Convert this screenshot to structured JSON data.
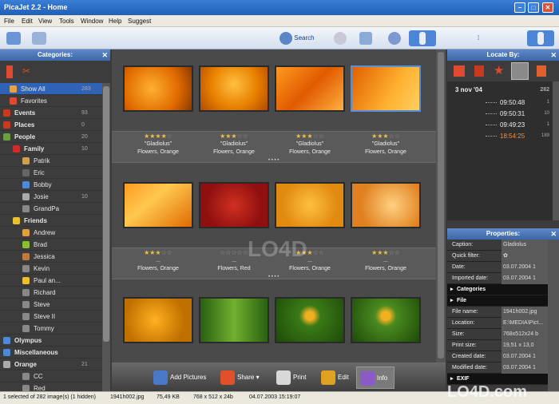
{
  "window": {
    "title": "PicaJet 2.2 - Home"
  },
  "menu": [
    "File",
    "Edit",
    "View",
    "Tools",
    "Window",
    "Help",
    "Suggest"
  ],
  "toolbar": {
    "search_label": "Search"
  },
  "categories_panel": {
    "title": "Categories:",
    "items": [
      {
        "label": "Show All",
        "count": "283"
      },
      {
        "label": "Favorites",
        "count": ""
      },
      {
        "label": "Events",
        "count": "93"
      },
      {
        "label": "Places",
        "count": "0"
      },
      {
        "label": "People",
        "count": "20"
      },
      {
        "label": "Family",
        "count": "10"
      },
      {
        "label": "Patrik",
        "count": ""
      },
      {
        "label": "Eric",
        "count": ""
      },
      {
        "label": "Bobby",
        "count": ""
      },
      {
        "label": "Josie",
        "count": "10"
      },
      {
        "label": "GrandPa",
        "count": ""
      },
      {
        "label": "Friends",
        "count": ""
      },
      {
        "label": "Andrew",
        "count": ""
      },
      {
        "label": "Brad",
        "count": ""
      },
      {
        "label": "Jessica",
        "count": ""
      },
      {
        "label": "Kevin",
        "count": ""
      },
      {
        "label": "Paul an...",
        "count": ""
      },
      {
        "label": "Richard",
        "count": ""
      },
      {
        "label": "Steve",
        "count": ""
      },
      {
        "label": "Steve II",
        "count": ""
      },
      {
        "label": "Tommy",
        "count": ""
      },
      {
        "label": "Olympus",
        "count": ""
      },
      {
        "label": "Miscellaneous",
        "count": ""
      },
      {
        "label": "Orange",
        "count": "21"
      },
      {
        "label": "CC",
        "count": ""
      },
      {
        "label": "Red",
        "count": ""
      }
    ]
  },
  "thumbnails": {
    "row1": [
      {
        "stars": 4,
        "title": "\"Gladiolus\"",
        "tags": "Flowers, Orange"
      },
      {
        "stars": 3,
        "title": "\"Gladiolus\"",
        "tags": "Flowers, Orange"
      },
      {
        "stars": 3,
        "title": "\"Gladiolus\"",
        "tags": "Flowers, Orange"
      },
      {
        "stars": 3,
        "title": "\"Gladiolus\"",
        "tags": "Flowers, Orange"
      }
    ],
    "row2": [
      {
        "stars": 3,
        "title": "...",
        "tags": "Flowers, Orange"
      },
      {
        "stars": 0,
        "title": "...",
        "tags": "Flowers, Red"
      },
      {
        "stars": 3,
        "title": "...",
        "tags": "Flowers, Orange"
      },
      {
        "stars": 3,
        "title": "...",
        "tags": "Flowers, Orange"
      }
    ],
    "band_dots": "• • • •"
  },
  "bottom_actions": {
    "add": "Add Pictures",
    "share": "Share",
    "print": "Print",
    "edit": "Edit",
    "info": "Info"
  },
  "locate_panel": {
    "title": "Locate By:",
    "date": "3 nov '04",
    "date_count": "282",
    "times": [
      {
        "time": "09:50:48",
        "count": "1"
      },
      {
        "time": "09:50:31",
        "count": "10"
      },
      {
        "time": "09:49:23",
        "count": "1"
      },
      {
        "time": "18:54:25",
        "count": "189"
      }
    ]
  },
  "properties_panel": {
    "title": "Properties:",
    "rows": [
      {
        "k": "Caption:",
        "v": "Gladiolus"
      },
      {
        "k": "Quick filter:",
        "v": "✿"
      },
      {
        "k": "Date:",
        "v": "03.07.2004 1"
      },
      {
        "k": "Imported date:",
        "v": "03.07.2004 1"
      }
    ],
    "section_categories": "Categories",
    "section_file": "File",
    "file_rows": [
      {
        "k": "File name:",
        "v": "1941h002.jpg"
      },
      {
        "k": "Location:",
        "v": "E:\\MEDIA\\Pict..."
      },
      {
        "k": "Size:",
        "v": "768x512x24 b"
      },
      {
        "k": "Print size:",
        "v": "19,51 x 13,0"
      },
      {
        "k": "Created date:",
        "v": "03.07.2004 1"
      },
      {
        "k": "Modified date:",
        "v": "03.07.2004 1"
      }
    ],
    "section_exif": "EXIF"
  },
  "status": {
    "selection": "1 selected of 282 image(s) (1 hidden)",
    "filename": "1941h002.jpg",
    "filesize": "75,49 KB",
    "dimensions": "768 x 512 x 24b",
    "date": "04.07.2003 15:19:07"
  },
  "watermark": "LO4D.com"
}
